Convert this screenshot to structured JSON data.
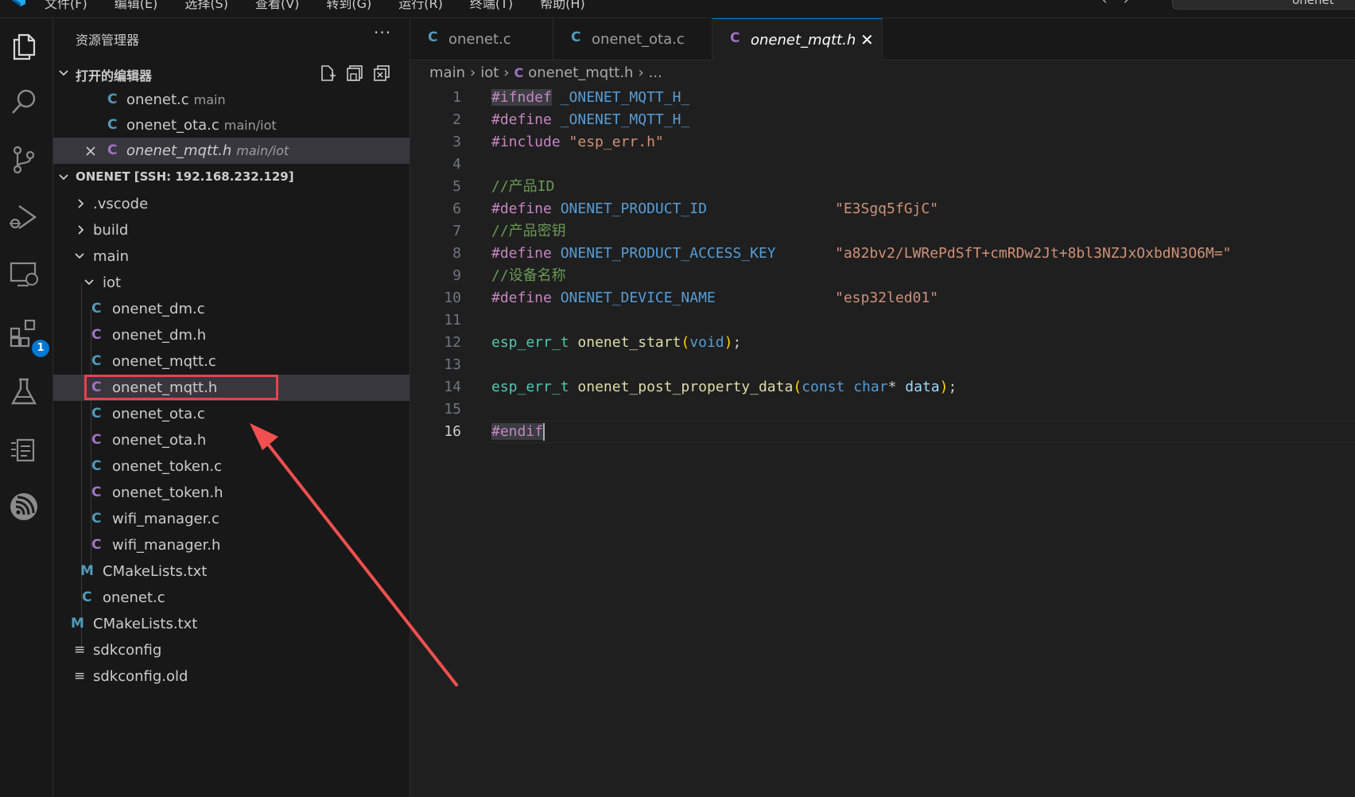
{
  "menubar": {
    "items": [
      "文件(F)",
      "编辑(E)",
      "选择(S)",
      "查看(V)",
      "转到(G)",
      "运行(R)",
      "终端(T)",
      "帮助(H)"
    ],
    "command_center_text": "onenet"
  },
  "activitybar": {
    "items": [
      "files-icon",
      "search-icon",
      "source-control-icon",
      "run-debug-icon",
      "remote-explorer-icon",
      "extensions-icon",
      "testing-icon",
      "clipboard-icon",
      "espressif-icon"
    ],
    "extensions_badge": "1"
  },
  "sidebar": {
    "title": "资源管理器",
    "more": "···",
    "open_editors": {
      "label": "打开的编辑器",
      "items": [
        {
          "icon": "C",
          "name": "onenet.c",
          "desc": "main"
        },
        {
          "icon": "C",
          "name": "onenet_ota.c",
          "desc": "main/iot"
        },
        {
          "icon": "C",
          "name": "onenet_mqtt.h",
          "desc": "main/iot"
        }
      ]
    },
    "workspace": {
      "label": "ONENET [SSH: 192.168.232.129]",
      "tree": [
        {
          "name": ".vscode"
        },
        {
          "name": "build"
        },
        {
          "name": "main"
        },
        {
          "name": "iot"
        },
        {
          "icon": "C",
          "name": "onenet_dm.c"
        },
        {
          "icon": "C",
          "name": "onenet_dm.h"
        },
        {
          "icon": "C",
          "name": "onenet_mqtt.c"
        },
        {
          "icon": "C",
          "name": "onenet_mqtt.h"
        },
        {
          "icon": "C",
          "name": "onenet_ota.c"
        },
        {
          "icon": "C",
          "name": "onenet_ota.h"
        },
        {
          "icon": "C",
          "name": "onenet_token.c"
        },
        {
          "icon": "C",
          "name": "onenet_token.h"
        },
        {
          "icon": "C",
          "name": "wifi_manager.c"
        },
        {
          "icon": "C",
          "name": "wifi_manager.h"
        },
        {
          "icon": "M",
          "name": "CMakeLists.txt"
        },
        {
          "icon": "C",
          "name": "onenet.c"
        },
        {
          "icon": "M",
          "name": "CMakeLists.txt"
        },
        {
          "icon": "≡",
          "name": "sdkconfig"
        },
        {
          "icon": "≡",
          "name": "sdkconfig.old"
        }
      ]
    }
  },
  "editor": {
    "tabs": [
      {
        "icon": "C",
        "name": "onenet.c"
      },
      {
        "icon": "C",
        "name": "onenet_ota.c"
      },
      {
        "icon": "C",
        "name": "onenet_mqtt.h",
        "close": "✕"
      }
    ],
    "breadcrumb": {
      "parts": [
        "main",
        "iot"
      ],
      "file_icon": "C",
      "file": "onenet_mqtt.h",
      "tail": "..."
    },
    "line_numbers": [
      "1",
      "2",
      "3",
      "4",
      "5",
      "6",
      "7",
      "8",
      "9",
      "10",
      "11",
      "12",
      "13",
      "14",
      "15",
      "16"
    ],
    "code": {
      "l1_kw": "#ifndef",
      "l1_name": "_ONENET_MQTT_H_",
      "l2_kw": "#define",
      "l2_name": "_ONENET_MQTT_H_",
      "l3_kw": "#include",
      "l3_str": "\"esp_err.h\"",
      "l5_cmt": "//产品ID",
      "l6_kw": "#define",
      "l6_name": "ONENET_PRODUCT_ID",
      "l6_str": "\"E3Sgq5fGjC\"",
      "l7_cmt": "//产品密钥",
      "l8_kw": "#define",
      "l8_name": "ONENET_PRODUCT_ACCESS_KEY",
      "l8_str": "\"a82bv2/LWRePdSfT+cmRDw2Jt+8bl3NZJxOxbdN3O6M=\"",
      "l9_cmt": "//设备名称",
      "l10_kw": "#define",
      "l10_name": "ONENET_DEVICE_NAME",
      "l10_str": "\"esp32led01\"",
      "l12_type": "esp_err_t",
      "l12_fn": "onenet_start",
      "l12_lp": "(",
      "l12_kw": "void",
      "l12_rp": ")",
      "l12_semi": ";",
      "l14_type": "esp_err_t",
      "l14_fn": "onenet_post_property_data",
      "l14_lp": "(",
      "l14_kw1": "const",
      "l14_kw2": "char",
      "l14_star": "*",
      "l14_var": "data",
      "l14_rp": ")",
      "l14_semi": ";",
      "l16_kw": "#endif"
    }
  },
  "colors": {
    "highlight_box": "#e8414f",
    "arrow": "#f0504f",
    "accent": "#0078d4"
  }
}
